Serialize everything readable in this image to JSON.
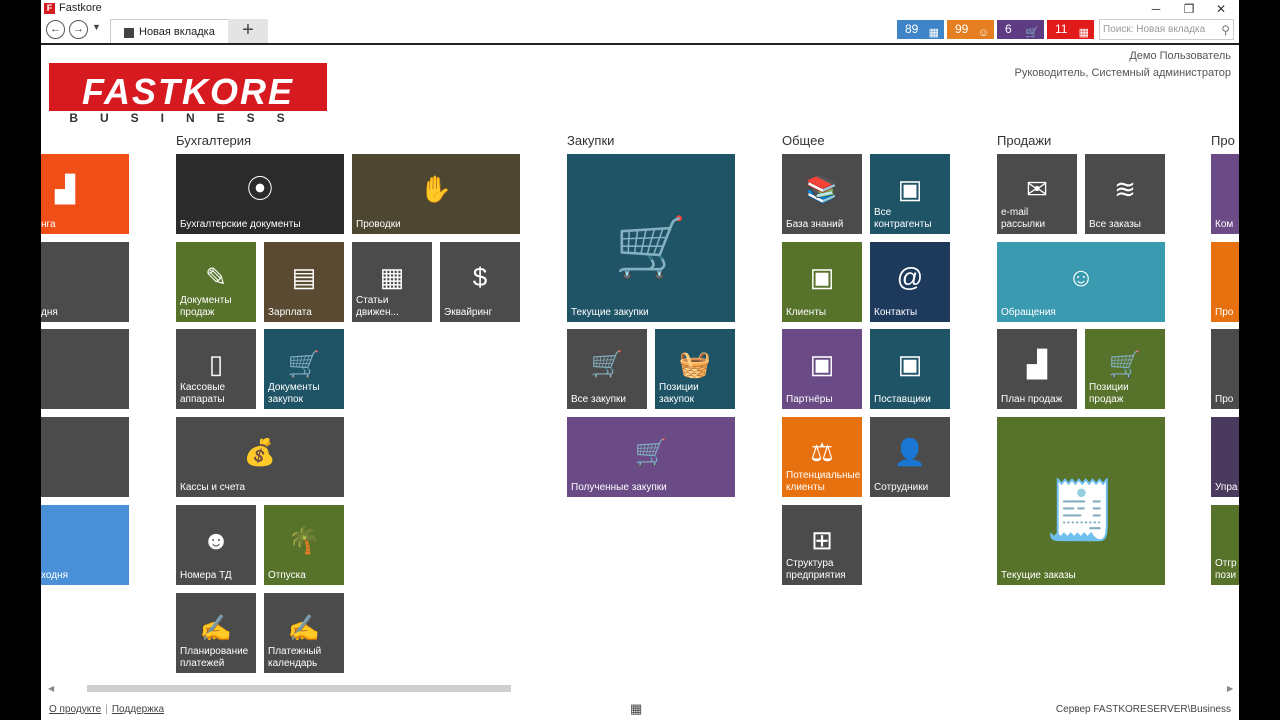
{
  "window": {
    "title": "Fastkore",
    "min": "─",
    "max": "❐",
    "close": "✕"
  },
  "tabs": {
    "active_label": "Новая вкладка",
    "new_tab": "+"
  },
  "badges": [
    {
      "value": "89",
      "color": "#3e84c6",
      "icon": "calendar-icon"
    },
    {
      "value": "99",
      "color": "#e67e22",
      "icon": "support-icon"
    },
    {
      "value": "6",
      "color": "#5d3c84",
      "icon": "cart-icon"
    },
    {
      "value": "11",
      "color": "#e11a1a",
      "icon": "calendar-icon"
    }
  ],
  "search": {
    "placeholder": "Поиск: Новая вкладка"
  },
  "user": {
    "name": "Демо Пользователь",
    "role": "Руководитель, Системный администратор"
  },
  "logo": {
    "word": "FASTKORE",
    "sub": "BUSINESS"
  },
  "sections": {
    "accounting": "Бухгалтерия",
    "purchases": "Закупки",
    "general": "Общее",
    "sales": "Продажи",
    "partial": "Про"
  },
  "tiles": {
    "left_partial": [
      "нга",
      "дня",
      "",
      "",
      "ходня"
    ],
    "accounting": [
      "Бухгалтерские документы",
      "Проводки",
      "Документы продаж",
      "Зарплата",
      "Статьи движен...",
      "Эквайринг",
      "Кассовые аппараты",
      "Документы закупок",
      "Кассы и счета",
      "Номера ТД",
      "Отпуска",
      "Планирование платежей",
      "Платежный календарь"
    ],
    "purchases": [
      "Текущие закупки",
      "Все закупки",
      "Позиции закупок",
      "Полученные закупки"
    ],
    "general": [
      "База знаний",
      "Все контрагенты",
      "Клиенты",
      "Контакты",
      "Партнёры",
      "Поставщики",
      "Потенциальные клиенты",
      "Сотрудники",
      "Структура предприятия"
    ],
    "sales": [
      "e-mail рассылки",
      "Все заказы",
      "Обращения",
      "План продаж",
      "Позиции продаж",
      "Текущие заказы"
    ],
    "right_partial": [
      "Ком",
      "Про",
      "Про",
      "Упра",
      "Отгр пози"
    ]
  },
  "colors": {
    "orange_red": "#f04e17",
    "dark": "#2b2b2b",
    "olive_dark": "#4d4631",
    "olive": "#56722b",
    "brown": "#5a4a31",
    "grey": "#4b4b4b",
    "teal": "#1f5466",
    "navy": "#1d3a5c",
    "purple": "#6a4b86",
    "orange": "#e8710f",
    "light_teal": "#3a9bb0",
    "blue": "#4a90d9"
  },
  "footer": {
    "about": "О продукте",
    "support": "Поддержка",
    "server": "Сервер FASTKORESERVER\\Business"
  }
}
